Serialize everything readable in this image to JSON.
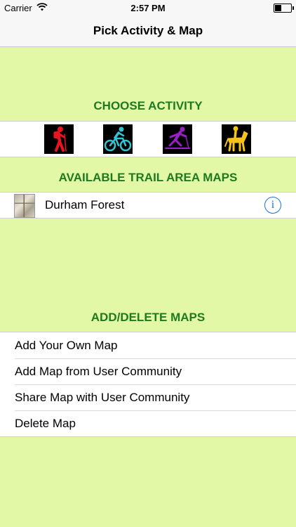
{
  "status_bar": {
    "carrier": "Carrier",
    "time": "2:57 PM"
  },
  "nav": {
    "title": "Pick Activity & Map"
  },
  "sections": {
    "choose_activity": "CHOOSE ACTIVITY",
    "available_maps": "AVAILABLE TRAIL AREA MAPS",
    "add_delete": "ADD/DELETE MAPS"
  },
  "activities": [
    {
      "icon": "hiker-icon",
      "color": "#e8161c"
    },
    {
      "icon": "cyclist-icon",
      "color": "#31c6d3"
    },
    {
      "icon": "skier-icon",
      "color": "#9a1ec9"
    },
    {
      "icon": "horse-rider-icon",
      "color": "#f6c316"
    }
  ],
  "maps": [
    {
      "name": "Durham Forest",
      "info_glyph": "i"
    }
  ],
  "actions": [
    "Add Your Own Map",
    "Add Map from User Community",
    "Share Map with User Community",
    "Delete Map"
  ]
}
